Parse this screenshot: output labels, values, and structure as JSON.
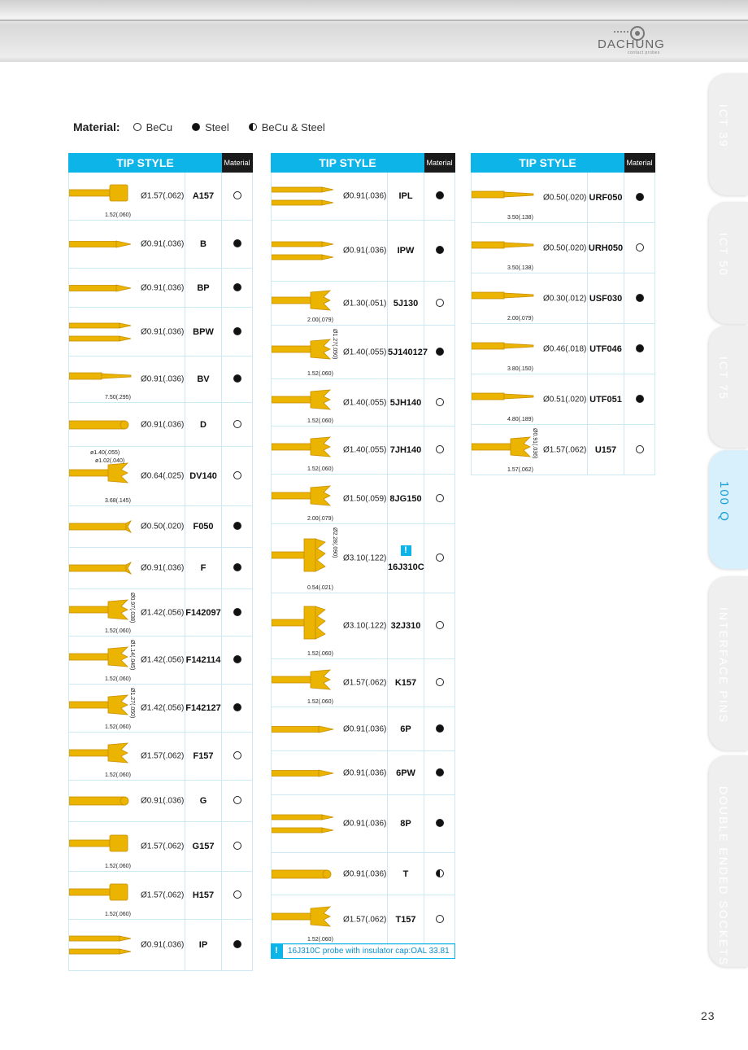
{
  "brand": {
    "name": "DACHUNG",
    "tagline": "contact probes"
  },
  "legend": {
    "title": "Material:",
    "items": [
      {
        "kind": "open",
        "label": "BeCu"
      },
      {
        "kind": "solid",
        "label": "Steel"
      },
      {
        "kind": "half",
        "label": "BeCu & Steel"
      }
    ]
  },
  "table_header": {
    "tip": "TIP STYLE",
    "material": "Material"
  },
  "col1": [
    {
      "dia": "Ø1.57(.062)",
      "code": "A157",
      "mat": "open",
      "dims": [
        "1.52(.060)"
      ]
    },
    {
      "dia": "Ø0.91(.036)",
      "code": "B",
      "mat": "solid",
      "dims": []
    },
    {
      "dia": "Ø0.91(.036)",
      "code": "BP",
      "mat": "solid",
      "dims": []
    },
    {
      "dia": "Ø0.91(.036)",
      "code": "BPW",
      "mat": "solid",
      "dims": []
    },
    {
      "dia": "Ø0.91(.036)",
      "code": "BV",
      "mat": "solid",
      "dims": [
        "7.50(.295)"
      ]
    },
    {
      "dia": "Ø0.91(.036)",
      "code": "D",
      "mat": "open",
      "dims": []
    },
    {
      "dia": "Ø0.64(.025)",
      "code": "DV140",
      "mat": "open",
      "dims": [
        "ø1.40(.055)",
        "ø1.02(.040)",
        "3.68(.145)"
      ]
    },
    {
      "dia": "Ø0.50(.020)",
      "code": "F050",
      "mat": "solid",
      "dims": []
    },
    {
      "dia": "Ø0.91(.036)",
      "code": "F",
      "mat": "solid",
      "dims": []
    },
    {
      "dia": "Ø1.42(.056)",
      "code": "F142097",
      "mat": "solid",
      "dims": [
        "1.52(.060)",
        "Ø0.97(.038)"
      ]
    },
    {
      "dia": "Ø1.42(.056)",
      "code": "F142114",
      "mat": "solid",
      "dims": [
        "1.52(.060)",
        "Ø1.14(.045)"
      ]
    },
    {
      "dia": "Ø1.42(.056)",
      "code": "F142127",
      "mat": "solid",
      "dims": [
        "1.52(.060)",
        "Ø1.27(.050)"
      ]
    },
    {
      "dia": "Ø1.57(.062)",
      "code": "F157",
      "mat": "open",
      "dims": [
        "1.52(.060)"
      ]
    },
    {
      "dia": "Ø0.91(.036)",
      "code": "G",
      "mat": "open",
      "dims": []
    },
    {
      "dia": "Ø1.57(.062)",
      "code": "G157",
      "mat": "open",
      "dims": [
        "1.52(.060)"
      ]
    },
    {
      "dia": "Ø1.57(.062)",
      "code": "H157",
      "mat": "open",
      "dims": [
        "1.52(.060)"
      ]
    },
    {
      "dia": "Ø0.91(.036)",
      "code": "IP",
      "mat": "solid",
      "dims": []
    }
  ],
  "col2": [
    {
      "dia": "Ø0.91(.036)",
      "code": "IPL",
      "mat": "solid",
      "dims": []
    },
    {
      "dia": "Ø0.91(.036)",
      "code": "IPW",
      "mat": "solid",
      "dims": []
    },
    {
      "dia": "Ø1.30(.051)",
      "code": "5J130",
      "mat": "open",
      "dims": [
        "2.00(.079)"
      ]
    },
    {
      "dia": "Ø1.40(.055)",
      "code": "5J140127",
      "mat": "solid",
      "dims": [
        "1.52(.060)",
        "Ø1.27(.050)"
      ]
    },
    {
      "dia": "Ø1.40(.055)",
      "code": "5JH140",
      "mat": "open",
      "dims": [
        "1.52(.060)"
      ]
    },
    {
      "dia": "Ø1.40(.055)",
      "code": "7JH140",
      "mat": "open",
      "dims": [
        "1.52(.060)"
      ]
    },
    {
      "dia": "Ø1.50(.059)",
      "code": "8JG150",
      "mat": "open",
      "dims": [
        "2.00(.079)"
      ]
    },
    {
      "dia": "Ø3.10(.122)",
      "code": "16J310C",
      "mat": "open",
      "dims": [
        "0.54(.021)",
        "Ø2.28(.090)"
      ],
      "flag": "!"
    },
    {
      "dia": "Ø3.10(.122)",
      "code": "32J310",
      "mat": "open",
      "dims": [
        "1.52(.060)"
      ]
    },
    {
      "dia": "Ø1.57(.062)",
      "code": "K157",
      "mat": "open",
      "dims": [
        "1.52(.060)"
      ]
    },
    {
      "dia": "Ø0.91(.036)",
      "code": "6P",
      "mat": "solid",
      "dims": []
    },
    {
      "dia": "Ø0.91(.036)",
      "code": "6PW",
      "mat": "solid",
      "dims": []
    },
    {
      "dia": "Ø0.91(.036)",
      "code": "8P",
      "mat": "solid",
      "dims": []
    },
    {
      "dia": "Ø0.91(.036)",
      "code": "T",
      "mat": "half",
      "dims": []
    },
    {
      "dia": "Ø1.57(.062)",
      "code": "T157",
      "mat": "open",
      "dims": [
        "1.52(.060)"
      ]
    }
  ],
  "col3": [
    {
      "dia": "Ø0.50(.020)",
      "code": "URF050",
      "mat": "solid",
      "dims": [
        "3.50(.138)"
      ]
    },
    {
      "dia": "Ø0.50(.020)",
      "code": "URH050",
      "mat": "open",
      "dims": [
        "3.50(.138)"
      ]
    },
    {
      "dia": "Ø0.30(.012)",
      "code": "USF030",
      "mat": "solid",
      "dims": [
        "2.00(.079)"
      ]
    },
    {
      "dia": "Ø0.46(.018)",
      "code": "UTF046",
      "mat": "solid",
      "dims": [
        "3.80(.150)"
      ]
    },
    {
      "dia": "Ø0.51(.020)",
      "code": "UTF051",
      "mat": "solid",
      "dims": [
        "4.80(.189)"
      ]
    },
    {
      "dia": "Ø1.57(.062)",
      "code": "U157",
      "mat": "open",
      "dims": [
        "1.57(.062)",
        "Ø0.91(.036)"
      ]
    }
  ],
  "note": {
    "icon": "!",
    "text": "16J310C probe with insulator cap:OAL 33.81"
  },
  "tabs": [
    {
      "label": "ICT 39",
      "active": false
    },
    {
      "label": "ICT 50",
      "active": false
    },
    {
      "label": "ICT 75",
      "active": false
    },
    {
      "label": "100 Q",
      "active": true
    },
    {
      "label": "INTERFACE PINS",
      "active": false
    },
    {
      "label": "DOUBLE ENDED SOCKETS",
      "active": false
    }
  ],
  "page_number": "23",
  "colors": {
    "accent": "#0cb4e8",
    "pin": "#e9b100"
  }
}
